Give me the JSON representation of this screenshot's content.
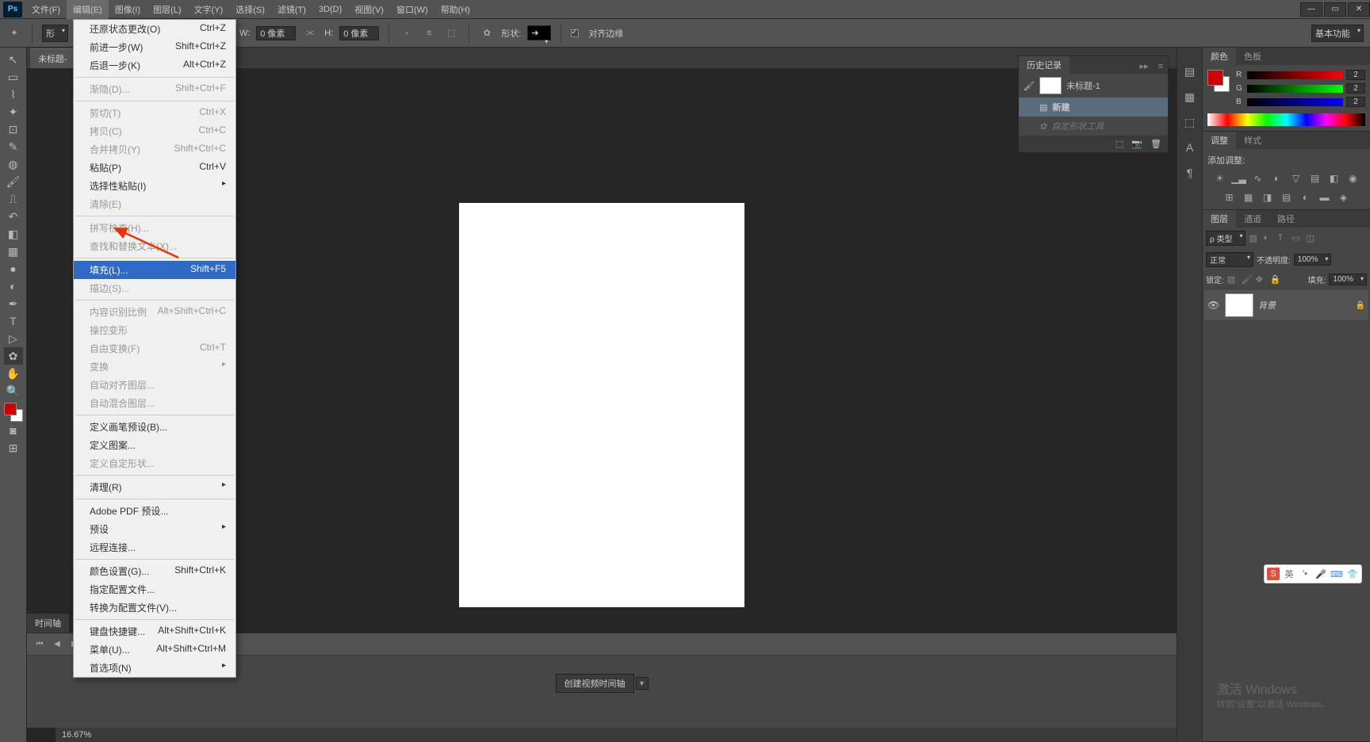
{
  "menubar": [
    "文件(F)",
    "编辑(E)",
    "图像(I)",
    "图层(L)",
    "文字(Y)",
    "选择(S)",
    "滤镜(T)",
    "3D(D)",
    "视图(V)",
    "窗口(W)",
    "帮助(H)"
  ],
  "options": {
    "shape_label": "形",
    "w_label": "W:",
    "w_val": "0 像素",
    "h_label": "H:",
    "h_val": "0 像素",
    "xing_label": "形状:",
    "align_label": "对齐边缘",
    "workspace": "基本功能"
  },
  "doc_tab": "未标题-",
  "zoom": "16.67%",
  "timeline_label": "时间轴",
  "timeline_btn": "创建视频时间轴",
  "context_menu": [
    {
      "l": "还原状态更改(O)",
      "s": "Ctrl+Z"
    },
    {
      "l": "前进一步(W)",
      "s": "Shift+Ctrl+Z"
    },
    {
      "l": "后退一步(K)",
      "s": "Alt+Ctrl+Z"
    },
    {
      "sep": true
    },
    {
      "l": "渐隐(D)...",
      "s": "Shift+Ctrl+F",
      "d": true
    },
    {
      "sep": true
    },
    {
      "l": "剪切(T)",
      "s": "Ctrl+X",
      "d": true
    },
    {
      "l": "拷贝(C)",
      "s": "Ctrl+C",
      "d": true
    },
    {
      "l": "合并拷贝(Y)",
      "s": "Shift+Ctrl+C",
      "d": true
    },
    {
      "l": "粘贴(P)",
      "s": "Ctrl+V"
    },
    {
      "l": "选择性粘贴(I)",
      "arr": true
    },
    {
      "l": "清除(E)",
      "d": true
    },
    {
      "sep": true
    },
    {
      "l": "拼写检查(H)...",
      "d": true
    },
    {
      "l": "查找和替换文本(X)...",
      "d": true
    },
    {
      "sep": true
    },
    {
      "l": "填充(L)...",
      "s": "Shift+F5",
      "hl": true
    },
    {
      "l": "描边(S)...",
      "d": true
    },
    {
      "sep": true
    },
    {
      "l": "内容识别比例",
      "s": "Alt+Shift+Ctrl+C",
      "d": true
    },
    {
      "l": "操控变形",
      "d": true
    },
    {
      "l": "自由变换(F)",
      "s": "Ctrl+T",
      "d": true
    },
    {
      "l": "变换",
      "arr": true,
      "d": true
    },
    {
      "l": "自动对齐图层...",
      "d": true
    },
    {
      "l": "自动混合图层...",
      "d": true
    },
    {
      "sep": true
    },
    {
      "l": "定义画笔预设(B)..."
    },
    {
      "l": "定义图案..."
    },
    {
      "l": "定义自定形状...",
      "d": true
    },
    {
      "sep": true
    },
    {
      "l": "清理(R)",
      "arr": true
    },
    {
      "sep": true
    },
    {
      "l": "Adobe PDF 预设..."
    },
    {
      "l": "预设",
      "arr": true
    },
    {
      "l": "远程连接..."
    },
    {
      "sep": true
    },
    {
      "l": "颜色设置(G)...",
      "s": "Shift+Ctrl+K"
    },
    {
      "l": "指定配置文件..."
    },
    {
      "l": "转换为配置文件(V)..."
    },
    {
      "sep": true
    },
    {
      "l": "键盘快捷键...",
      "s": "Alt+Shift+Ctrl+K"
    },
    {
      "l": "菜单(U)...",
      "s": "Alt+Shift+Ctrl+M"
    },
    {
      "l": "首选项(N)",
      "arr": true
    }
  ],
  "panels": {
    "history": "历史记录",
    "history_doc": "未标题-1",
    "history_new": "新建",
    "history_custom": "自定形状工具",
    "color": "颜色",
    "swatch": "色板",
    "r_v": "2",
    "g_v": "2",
    "b_v": "2",
    "adjust": "调整",
    "style": "样式",
    "add_adj": "添加调整:",
    "layers": "图层",
    "channels": "通道",
    "paths": "路径",
    "kind": "ρ 类型",
    "blend": "正常",
    "opacity_l": "不透明度:",
    "opacity_v": "100%",
    "lock_l": "锁定:",
    "fill_l": "填充:",
    "fill_v": "100%",
    "bg_layer": "背景"
  },
  "watermark1": "激活 Windows",
  "watermark2": "转到\"设置\"以激活 Windows。",
  "ime": "英"
}
